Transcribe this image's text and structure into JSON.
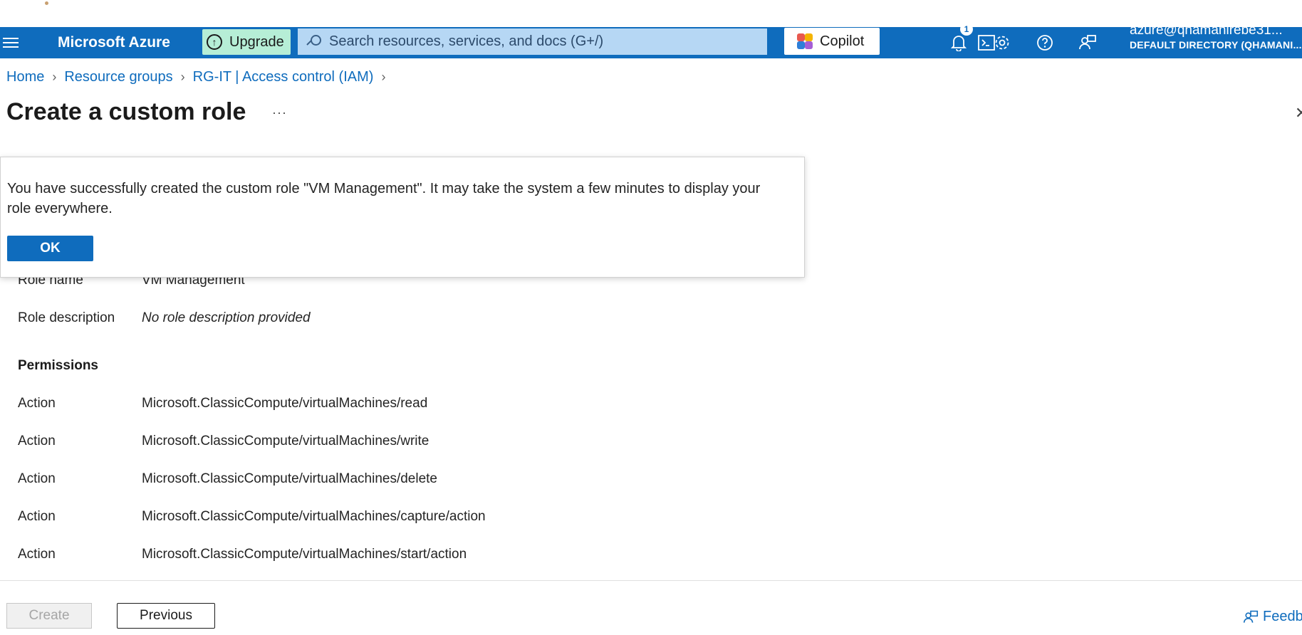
{
  "header": {
    "brand": "Microsoft Azure",
    "upgrade_label": "Upgrade",
    "search_placeholder": "Search resources, services, and docs (G+/)",
    "copilot_label": "Copilot",
    "notification_count": "1",
    "account_email": "azure@qhamanirebe31...",
    "account_directory": "DEFAULT DIRECTORY (QHAMANI..."
  },
  "breadcrumb": [
    "Home",
    "Resource groups",
    "RG-IT | Access control (IAM)"
  ],
  "page": {
    "title": "Create a custom role",
    "more_label": "···"
  },
  "dialog": {
    "message": "You have successfully created the custom role \"VM Management\". It may take the system a few minutes to display your role everywhere.",
    "ok_label": "OK"
  },
  "summary": {
    "role_name_label": "Role name",
    "role_name_value": "VM Management",
    "role_description_label": "Role description",
    "role_description_value": "No role description provided",
    "permissions_heading": "Permissions",
    "permissions": [
      {
        "type": "Action",
        "value": "Microsoft.ClassicCompute/virtualMachines/read"
      },
      {
        "type": "Action",
        "value": "Microsoft.ClassicCompute/virtualMachines/write"
      },
      {
        "type": "Action",
        "value": "Microsoft.ClassicCompute/virtualMachines/delete"
      },
      {
        "type": "Action",
        "value": "Microsoft.ClassicCompute/virtualMachines/capture/action"
      },
      {
        "type": "Action",
        "value": "Microsoft.ClassicCompute/virtualMachines/start/action"
      }
    ]
  },
  "footer": {
    "create_label": "Create",
    "previous_label": "Previous",
    "feedback_label": "Feedback"
  },
  "colors": {
    "nav_blue": "#0f6cbd",
    "upgrade_bg": "#b6eed6",
    "search_bg": "#b6d7f4"
  },
  "icons": [
    "hamburger-icon",
    "upgrade-icon",
    "search-icon",
    "copilot-icon",
    "cloud-shell-icon",
    "bell-icon",
    "gear-icon",
    "help-icon",
    "feedback-person-icon",
    "close-icon",
    "chevron-right-icon"
  ]
}
